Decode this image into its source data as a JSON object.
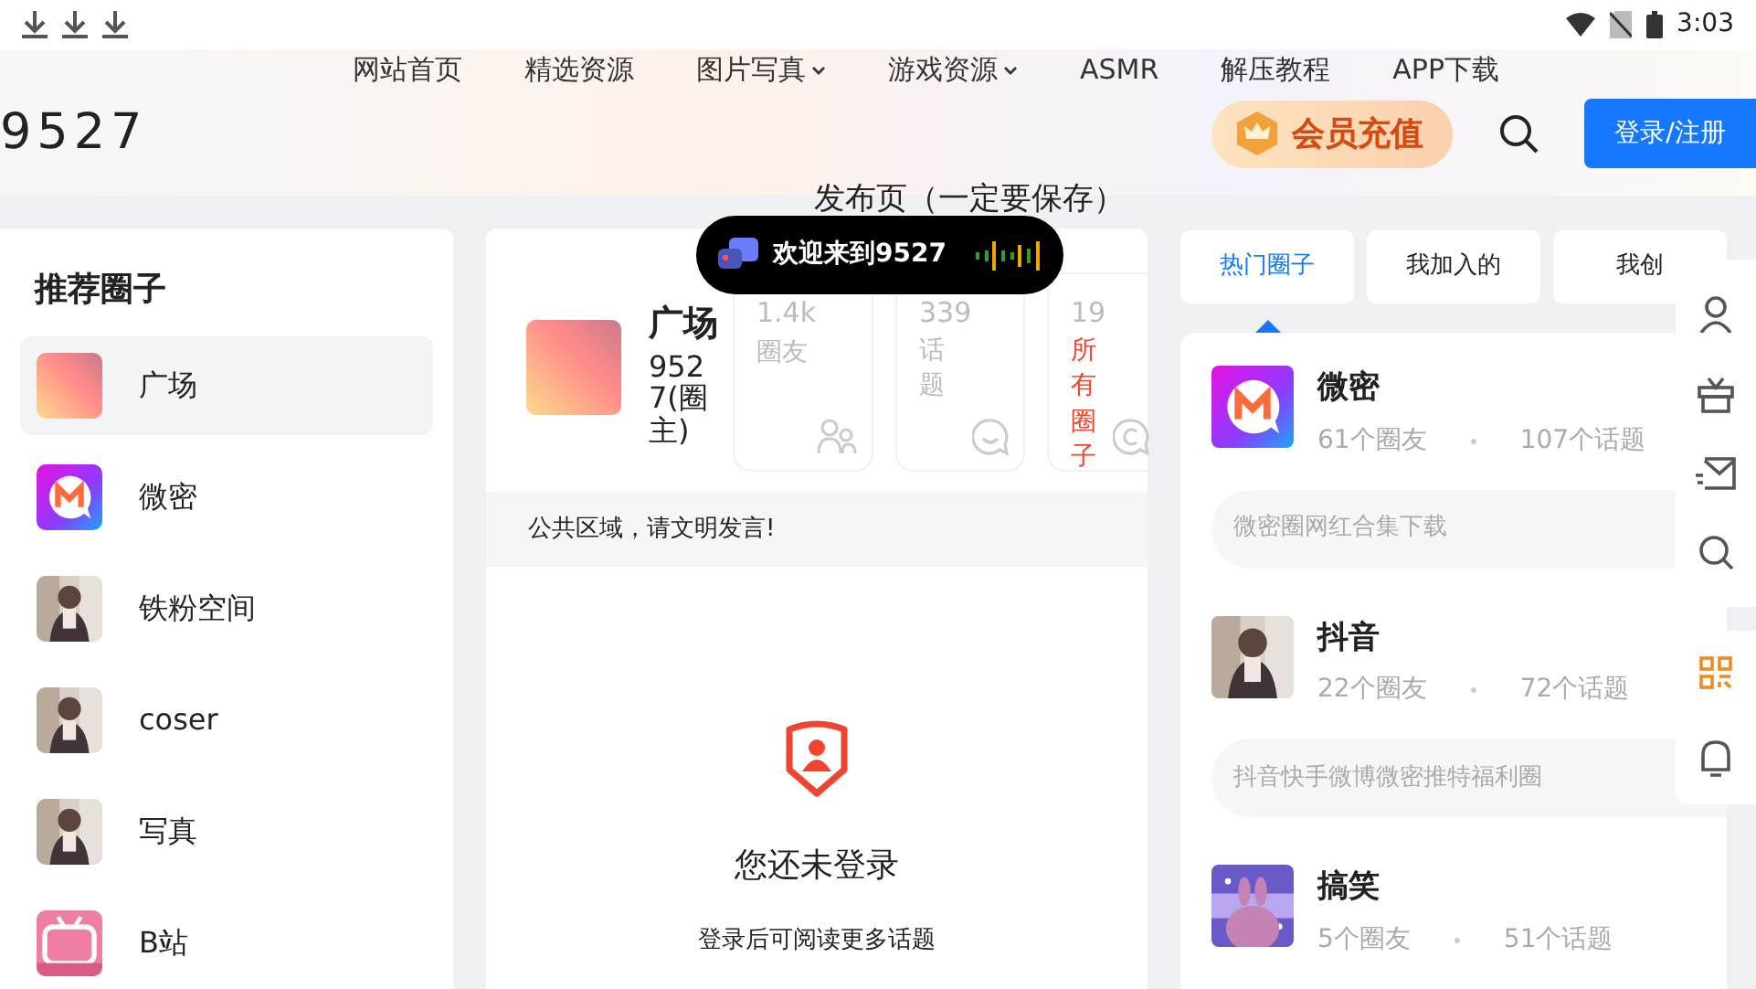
{
  "status_bar": {
    "time": "3:03"
  },
  "nav": [
    {
      "label": "网站首页",
      "dropdown": false
    },
    {
      "label": "精选资源",
      "dropdown": false
    },
    {
      "label": "图片写真",
      "dropdown": true
    },
    {
      "label": "游戏资源",
      "dropdown": true
    },
    {
      "label": "ASMR",
      "dropdown": false
    },
    {
      "label": "解压教程",
      "dropdown": false
    },
    {
      "label": "APP下载",
      "dropdown": false
    }
  ],
  "header": {
    "logo": "9527",
    "vip_button": "会员充值",
    "login_button": "登录/注册"
  },
  "page_title": "发布页（一定要保存）",
  "sidebar": {
    "title": "推荐圈子",
    "items": [
      {
        "label": "广场",
        "selected": true,
        "kind": "gradient"
      },
      {
        "label": "微密",
        "selected": false,
        "kind": "m-logo"
      },
      {
        "label": "铁粉空间",
        "selected": false,
        "kind": "picture"
      },
      {
        "label": "coser",
        "selected": false,
        "kind": "picture"
      },
      {
        "label": "写真",
        "selected": false,
        "kind": "picture"
      },
      {
        "label": "B站",
        "selected": false,
        "kind": "tv-logo"
      }
    ]
  },
  "toast": {
    "text": "欢迎来到9527"
  },
  "circle": {
    "name": "广场",
    "owner": "9527(圈主)",
    "stats": [
      {
        "value": "1.4k",
        "label": "圈友",
        "kind": "members"
      },
      {
        "value": "339",
        "label": "话题",
        "kind": "topics"
      },
      {
        "value": "19",
        "label": "所有圈子",
        "kind": "all"
      }
    ],
    "notice": "公共区域，请文明发言!"
  },
  "login_prompt": {
    "title": "您还未登录",
    "subtitle": "登录后可阅读更多话题"
  },
  "tabs": [
    {
      "label": "热门圈子",
      "selected": true
    },
    {
      "label": "我加入的",
      "selected": false
    },
    {
      "label": "我创",
      "selected": false
    }
  ],
  "hot_circles": [
    {
      "name": "微密",
      "members": "61个圈友",
      "topics": "107个话题",
      "description": "微密圈网红合集下载",
      "kind": "m-logo"
    },
    {
      "name": "抖音",
      "members": "22个圈友",
      "topics": "72个话题",
      "description": "抖音快手微博微密推特福利圈",
      "kind": "picture"
    },
    {
      "name": "搞笑",
      "members": "5个圈友",
      "topics": "51个话题",
      "kind": "cartoon"
    }
  ]
}
